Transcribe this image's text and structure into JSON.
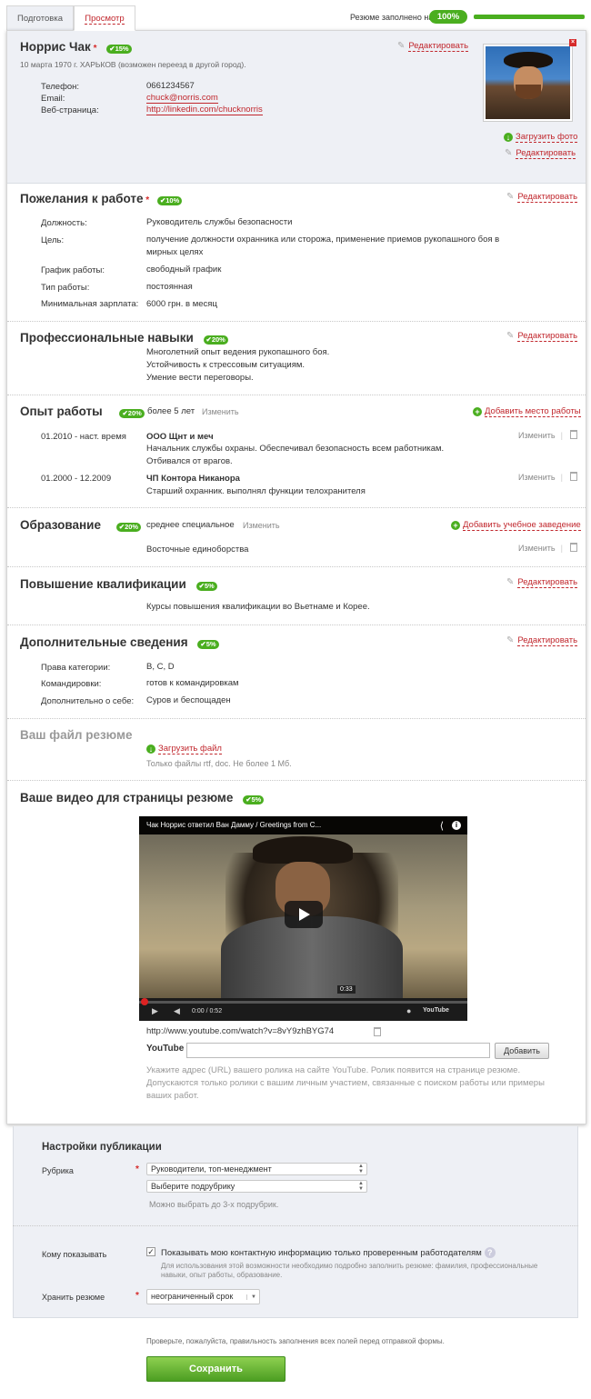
{
  "tabs": {
    "prepare": "Подготовка",
    "preview": "Просмотр"
  },
  "progress": {
    "label": "Резюме заполнено на",
    "badge": "100%",
    "value": 1.0
  },
  "profile": {
    "name": "Норрис Чак",
    "star": "*",
    "badge": "15%",
    "details": "10 марта 1970 г. ХАРЬКОВ (возможен переезд в другой город).",
    "edit": "Редактировать",
    "contacts": [
      {
        "label": "Телефон:",
        "value": "0661234567"
      },
      {
        "label": "Email:",
        "value": "chuck@norris.com"
      },
      {
        "label": "Веб-страница:",
        "value": "http://linkedin.com/chucknorris"
      }
    ],
    "upload_photo": "Загрузить фото",
    "edit_photo": "Редактировать",
    "close": "×"
  },
  "wishes": {
    "title": "Пожелания к работе",
    "star": "*",
    "badge": "10%",
    "edit": "Редактировать",
    "rows": [
      {
        "label": "Должность:",
        "value": "Руководитель службы безопасности"
      },
      {
        "label": "Цель:",
        "value": "получение должности охранника или сторожа, применение приемов рукопашного боя в мирных целях"
      },
      {
        "label": "График работы:",
        "value": "свободный график"
      },
      {
        "label": "Тип работы:",
        "value": "постоянная"
      },
      {
        "label": "Минимальная зарплата:",
        "value": "6000 грн. в месяц"
      }
    ]
  },
  "skills": {
    "title": "Профессиональные навыки",
    "badge": "20%",
    "edit": "Редактировать",
    "lines": [
      "Многолетний опыт ведения рукопашного боя.",
      "Устойчивость к стрессовым ситуациям.",
      "Умение вести переговоры."
    ]
  },
  "experience": {
    "title": "Опыт работы",
    "badge": "20%",
    "summary": "более 5 лет",
    "change": "Изменить",
    "add": "Добавить место работы",
    "jobs": [
      {
        "period": "01.2010 - наст. время",
        "company": "ООО Щнт и меч",
        "desc": "Начальник службы охраны. Обеспечивал безопасность всем работникам. Отбивался от врагов.",
        "change": "Изменить"
      },
      {
        "period": "01.2000 - 12.2009",
        "company": "ЧП Контора Никанора",
        "desc": "Старший охранник. выполнял функции телохранителя",
        "change": "Изменить"
      }
    ]
  },
  "education": {
    "title": "Образование",
    "badge": "20%",
    "level": "среднее специальное",
    "change": "Изменить",
    "add": "Добавить учебное заведение",
    "item": "Восточные единоборства",
    "item_change": "Изменить"
  },
  "qualification": {
    "title": "Повышение квалификации",
    "badge": "5%",
    "edit": "Редактировать",
    "text": "Курсы повышения квалификации во Вьетнаме и Корее."
  },
  "additional": {
    "title": "Дополнительные сведения",
    "badge": "5%",
    "edit": "Редактировать",
    "rows": [
      {
        "label": "Права категории:",
        "value": "B, C, D"
      },
      {
        "label": "Командировки:",
        "value": "готов к командировкам"
      },
      {
        "label": "Дополнительно о себе:",
        "value": "Суров и беспощаден"
      }
    ]
  },
  "resume_file": {
    "title": "Ваш файл резюме",
    "upload": "Загрузить файл",
    "hint": "Только файлы rtf, doc. Не более 1 Мб."
  },
  "video": {
    "title": "Ваше видео для страницы резюме",
    "badge": "5%",
    "player_title": "Чак Норрис ответил Ван Дамму / Greetings from C...",
    "time": "0:00 / 0:52",
    "tooltip": "0:33",
    "yt": "YouTube",
    "url": "http://www.youtube.com/watch?v=8vY9zhBYG74",
    "add": "Добавить",
    "hint": "Укажите адрес (URL) вашего ролика на сайте YouTube. Ролик появится на странице резюме. Допускаются только ролики с вашим личным участием, связанные с поиском работы или примеры ваших работ."
  },
  "publication": {
    "title": "Настройки публикации",
    "rubric_label": "Рубрика",
    "star": "*",
    "rubric": "Руководители, топ-менеджмент",
    "subrubric": "Выберите подрубрику",
    "sub_hint": "Можно выбрать до 3-х подрубрик.",
    "show_label": "Кому показывать",
    "show_text": "Показывать мою контактную информацию только проверенным работодателям",
    "q": "?",
    "show_hint": "Для использования этой возможности необходимо подробно заполнить резюме: фамилия, профессиональные навыки, опыт работы, образование.",
    "keep_label": "Хранить резюме",
    "keep_value": "неограниченный срок"
  },
  "footer": {
    "note": "Проверьте, пожалуйста, правильность заполнения всех полей перед отправкой формы.",
    "save": "Сохранить"
  }
}
